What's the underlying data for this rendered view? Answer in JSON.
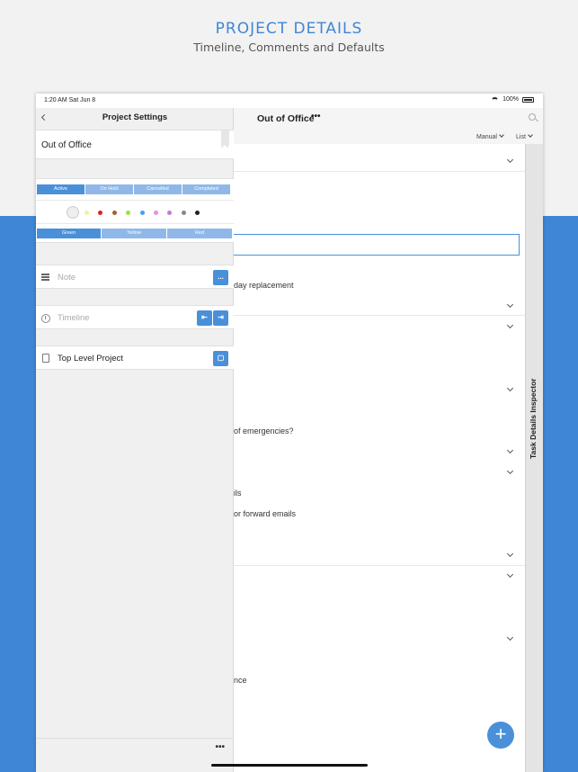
{
  "promo": {
    "title": "PROJECT DETAILS",
    "subtitle": "Timeline, Comments and Defaults"
  },
  "statusbar": {
    "time": "1:20 AM  Sat Jun 8",
    "battery": "100%"
  },
  "main": {
    "title": "Out of Office",
    "more": "•••",
    "sort_manual": "Manual",
    "view_list": "List",
    "fragments": [
      "day replacement",
      "of emergencies?",
      "ils",
      "or forward emails",
      "nce"
    ],
    "inspector_label": "Task Details Inspector",
    "add": "+"
  },
  "sidebar": {
    "title": "Project Settings",
    "project_name": "Out of Office",
    "status_options": [
      "Active",
      "On Hold",
      "Cancelled",
      "Completed"
    ],
    "selected_status": "Active",
    "colors": [
      "#f2f2a0",
      "#e02020",
      "#a0622a",
      "#9be043",
      "#4a9ff0",
      "#f08ae0",
      "#c07ae0",
      "#888888",
      "#222222"
    ],
    "flag_options": [
      "Green",
      "Yellow",
      "Red"
    ],
    "selected_flag": "Green",
    "note_placeholder": "Note",
    "note_button": "...",
    "timeline_placeholder": "Timeline",
    "timeline_start": "⇤",
    "timeline_end": "⇥",
    "parent": "Top Level Project",
    "parent_button": "▢",
    "more": "•••"
  },
  "colors": {
    "accent": "#4a90d9",
    "brand_band": "#3f86d6"
  }
}
